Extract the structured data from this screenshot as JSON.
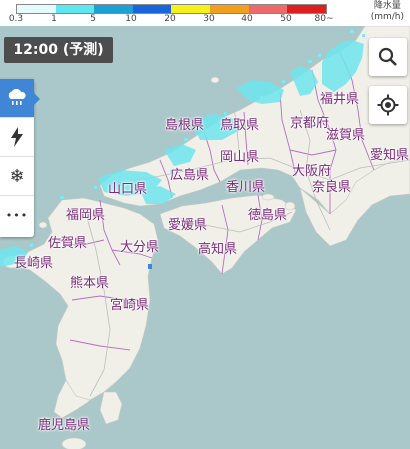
{
  "legend": {
    "unit": "降水量",
    "unit2": "(mm/h)",
    "ticks": [
      "0.3",
      "1",
      "5",
      "10",
      "20",
      "30",
      "40",
      "50",
      "80~"
    ],
    "colors": [
      "#e4fbff",
      "#5ee7f0",
      "#1ca0d6",
      "#1865dc",
      "#f6f01c",
      "#f0a01c",
      "#ee6a6a",
      "#dd1f1f",
      "#8b1a8f"
    ]
  },
  "time": {
    "label": "12:00 (予測)"
  },
  "sidebar": [
    {
      "name": "rain-cloud-icon",
      "glyph": "☂"
    },
    {
      "name": "lightning-icon",
      "glyph": "ϟ"
    },
    {
      "name": "snow-icon",
      "glyph": "❄"
    },
    {
      "name": "more-icon",
      "glyph": "•••"
    }
  ],
  "map": {
    "water_color": "#aac8c9",
    "land_color": "#f0efe8",
    "rain_color": "#6ee6ee",
    "prefectures": [
      {
        "name": "島根県"
      },
      {
        "name": "鳥取県"
      },
      {
        "name": "京都府"
      },
      {
        "name": "福井県"
      },
      {
        "name": "滋賀県"
      },
      {
        "name": "愛知県"
      },
      {
        "name": "岡山県"
      },
      {
        "name": "広島県"
      },
      {
        "name": "大阪府"
      },
      {
        "name": "香川県"
      },
      {
        "name": "奈良県"
      },
      {
        "name": "山口県"
      },
      {
        "name": "福岡県"
      },
      {
        "name": "愛媛県"
      },
      {
        "name": "徳島県"
      },
      {
        "name": "佐賀県"
      },
      {
        "name": "大分県"
      },
      {
        "name": "高知県"
      },
      {
        "name": "長崎県"
      },
      {
        "name": "熊本県"
      },
      {
        "name": "宮崎県"
      },
      {
        "name": "鹿児島県"
      }
    ]
  }
}
